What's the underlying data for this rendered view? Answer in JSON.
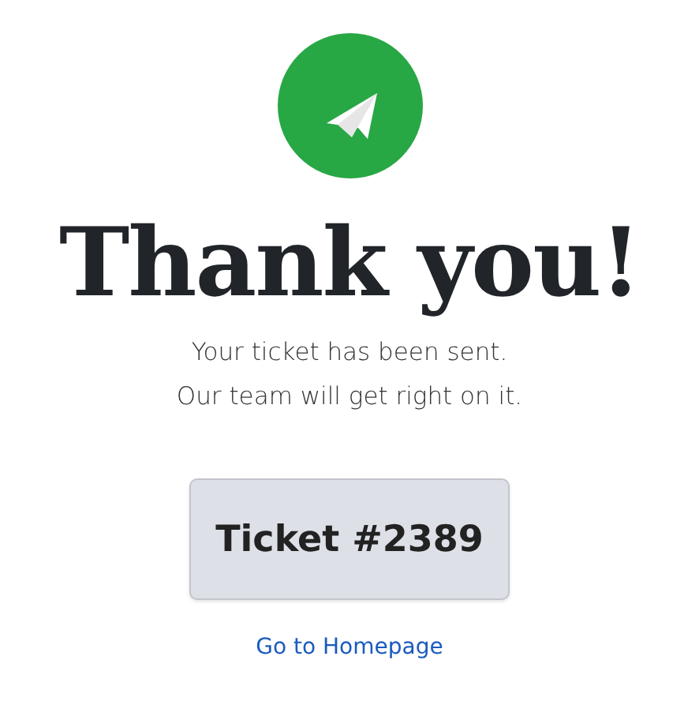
{
  "title": "Thank you!",
  "message_lines": [
    "Your ticket has been sent.",
    "Our team will get right on it."
  ],
  "ticket": "Ticket #2389",
  "link": "Go to Homepage"
}
